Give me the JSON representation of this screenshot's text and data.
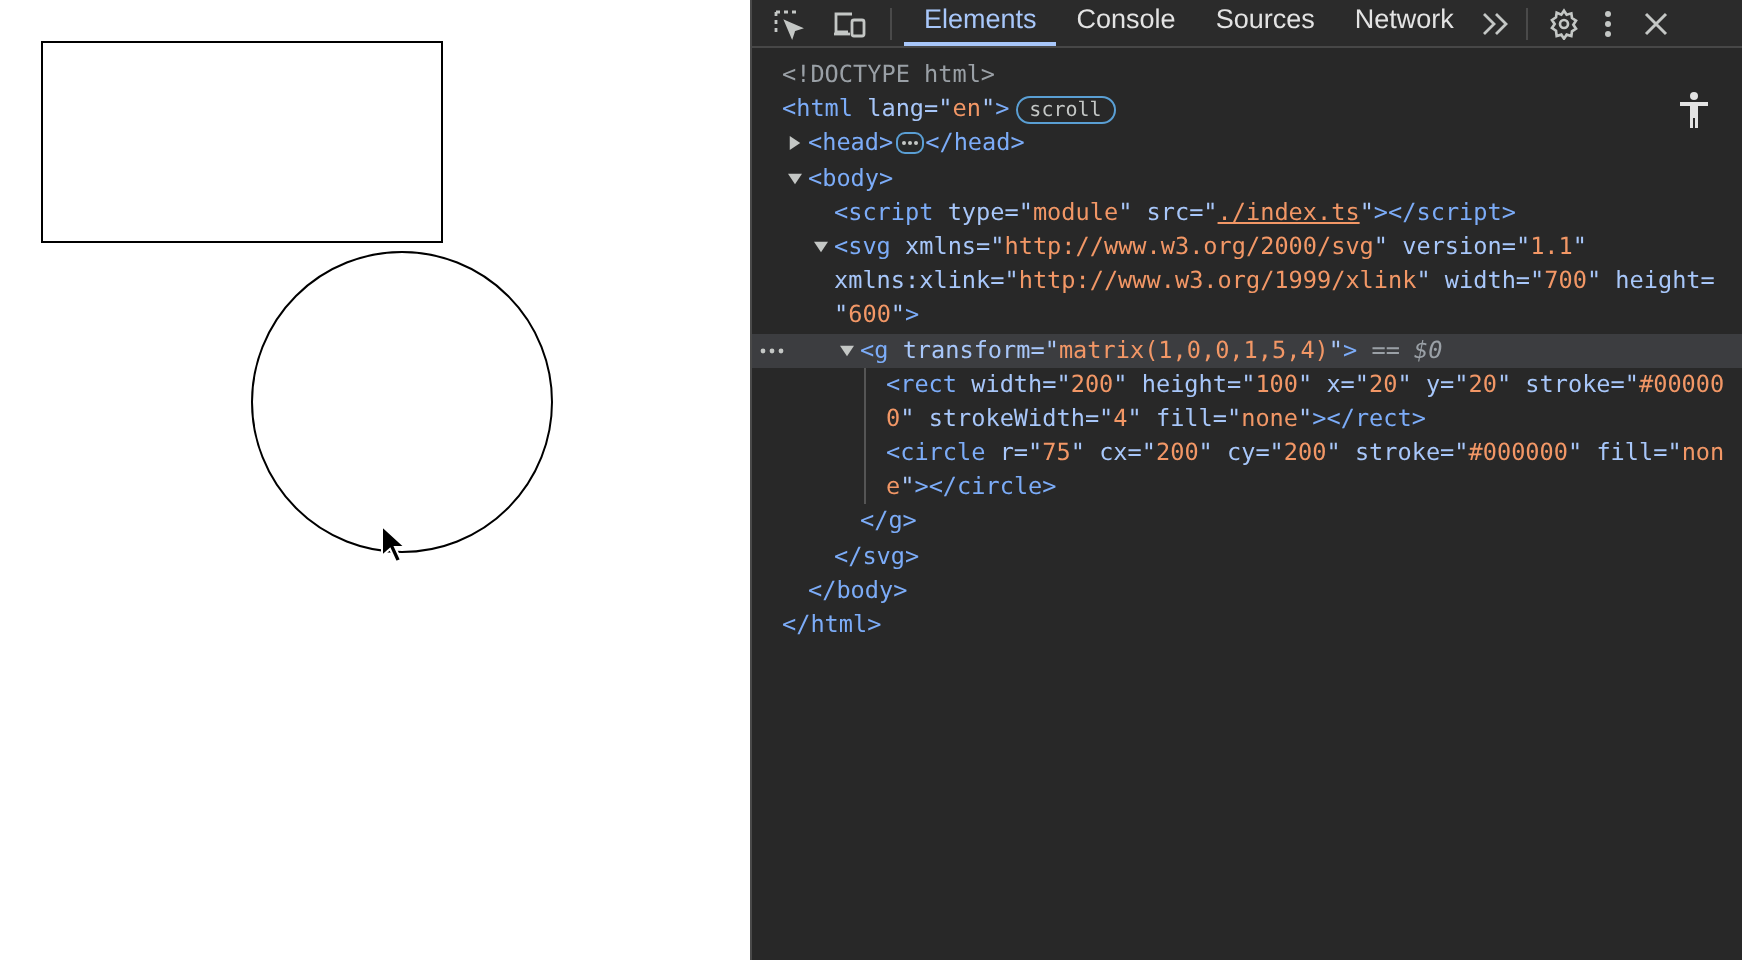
{
  "tabs": [
    {
      "label": "Elements",
      "selected": true
    },
    {
      "label": "Console",
      "selected": false
    },
    {
      "label": "Sources",
      "selected": false
    },
    {
      "label": "Network",
      "selected": false
    }
  ],
  "dom": [
    {
      "lines": [
        [
          {
            "kind": "doctype",
            "text": "<!DOCTYPE html>"
          }
        ]
      ],
      "selected": false
    },
    {
      "lines": [
        [
          {
            "kind": "tag",
            "text": "<html"
          },
          {
            "kind": "attr",
            "text": " lang=\""
          },
          {
            "kind": "value",
            "text": "en"
          },
          {
            "kind": "attr",
            "text": "\""
          },
          {
            "kind": "tag",
            "text": ">"
          }
        ]
      ],
      "badge": "scroll",
      "selected": false,
      "close": [
        {
          "kind": "tag",
          "text": "</html>"
        }
      ],
      "children": [
        {
          "lines": [
            [
              {
                "kind": "tag",
                "text": "<head>"
              }
            ]
          ],
          "selected": false,
          "expanded": false,
          "close": [
            {
              "kind": "tag",
              "text": "</head>"
            }
          ]
        },
        {
          "lines": [
            [
              {
                "kind": "tag",
                "text": "<body>"
              }
            ]
          ],
          "selected": false,
          "expanded": true,
          "close": [
            {
              "kind": "tag",
              "text": "</body>"
            }
          ],
          "children": [
            {
              "lines": [
                [
                  {
                    "kind": "tag",
                    "text": "<script"
                  },
                  {
                    "kind": "attr",
                    "text": " type=\""
                  },
                  {
                    "kind": "value",
                    "text": "module"
                  },
                  {
                    "kind": "attr",
                    "text": "\" src=\""
                  },
                  {
                    "kind": "link",
                    "text": "./index.ts"
                  },
                  {
                    "kind": "attr",
                    "text": "\""
                  },
                  {
                    "kind": "tag",
                    "text": ">"
                  }
                ]
              ],
              "selected": false,
              "close": [
                {
                  "kind": "tag",
                  "text": "</script>"
                }
              ]
            },
            {
              "lines": [
                [
                  {
                    "kind": "tag",
                    "text": "<svg"
                  },
                  {
                    "kind": "attr",
                    "text": " xmlns=\""
                  },
                  {
                    "kind": "value",
                    "text": "http://www.w3.org/2000/svg"
                  },
                  {
                    "kind": "attr",
                    "text": "\" version=\""
                  },
                  {
                    "kind": "value",
                    "text": "1.1"
                  },
                  {
                    "kind": "attr",
                    "text": "\""
                  }
                ],
                [
                  {
                    "kind": "attr",
                    "text": "xmlns:xlink=\""
                  },
                  {
                    "kind": "value",
                    "text": "http://www.w3.org/1999/xlink"
                  },
                  {
                    "kind": "attr",
                    "text": "\" width=\""
                  },
                  {
                    "kind": "value",
                    "text": "700"
                  },
                  {
                    "kind": "attr",
                    "text": "\" height="
                  }
                ],
                [
                  {
                    "kind": "attr",
                    "text": "\""
                  },
                  {
                    "kind": "value",
                    "text": "600"
                  },
                  {
                    "kind": "attr",
                    "text": "\""
                  },
                  {
                    "kind": "tag",
                    "text": ">"
                  }
                ]
              ],
              "selected": false,
              "expanded": true,
              "close": [
                {
                  "kind": "tag",
                  "text": "</svg>"
                }
              ],
              "children": [
                {
                  "lines": [
                    [
                      {
                        "kind": "tag",
                        "text": "<g"
                      },
                      {
                        "kind": "attr",
                        "text": " transform=\""
                      },
                      {
                        "kind": "value",
                        "text": "matrix(1,0,0,1,5,4)"
                      },
                      {
                        "kind": "attr",
                        "text": "\""
                      },
                      {
                        "kind": "tag",
                        "text": ">"
                      },
                      {
                        "kind": "marker",
                        "text": " == $0"
                      }
                    ]
                  ],
                  "selected": true,
                  "expanded": true,
                  "close": [
                    {
                      "kind": "tag",
                      "text": "</g>"
                    }
                  ],
                  "children": [
                    {
                      "lines": [
                        [
                          {
                            "kind": "tag",
                            "text": "<rect"
                          },
                          {
                            "kind": "attr",
                            "text": " width=\""
                          },
                          {
                            "kind": "value",
                            "text": "200"
                          },
                          {
                            "kind": "attr",
                            "text": "\" height=\""
                          },
                          {
                            "kind": "value",
                            "text": "100"
                          },
                          {
                            "kind": "attr",
                            "text": "\" x=\""
                          },
                          {
                            "kind": "value",
                            "text": "20"
                          },
                          {
                            "kind": "attr",
                            "text": "\" y=\""
                          },
                          {
                            "kind": "value",
                            "text": "20"
                          },
                          {
                            "kind": "attr",
                            "text": "\" stroke=\""
                          },
                          {
                            "kind": "value",
                            "text": "#00000"
                          }
                        ],
                        [
                          {
                            "kind": "value",
                            "text": "0"
                          },
                          {
                            "kind": "attr",
                            "text": "\" strokeWidth=\""
                          },
                          {
                            "kind": "value",
                            "text": "4"
                          },
                          {
                            "kind": "attr",
                            "text": "\" fill=\""
                          },
                          {
                            "kind": "value",
                            "text": "none"
                          },
                          {
                            "kind": "attr",
                            "text": "\""
                          },
                          {
                            "kind": "tag",
                            "text": ">"
                          }
                        ]
                      ],
                      "selected": false,
                      "close": [
                        {
                          "kind": "tag",
                          "text": "</rect>"
                        }
                      ]
                    },
                    {
                      "lines": [
                        [
                          {
                            "kind": "tag",
                            "text": "<circle"
                          },
                          {
                            "kind": "attr",
                            "text": " r=\""
                          },
                          {
                            "kind": "value",
                            "text": "75"
                          },
                          {
                            "kind": "attr",
                            "text": "\" cx=\""
                          },
                          {
                            "kind": "value",
                            "text": "200"
                          },
                          {
                            "kind": "attr",
                            "text": "\" cy=\""
                          },
                          {
                            "kind": "value",
                            "text": "200"
                          },
                          {
                            "kind": "attr",
                            "text": "\" stroke=\""
                          },
                          {
                            "kind": "value",
                            "text": "#000000"
                          },
                          {
                            "kind": "attr",
                            "text": "\" fill=\""
                          },
                          {
                            "kind": "value",
                            "text": "non"
                          }
                        ],
                        [
                          {
                            "kind": "value",
                            "text": "e"
                          },
                          {
                            "kind": "attr",
                            "text": "\""
                          },
                          {
                            "kind": "tag",
                            "text": ">"
                          }
                        ]
                      ],
                      "selected": false,
                      "close": [
                        {
                          "kind": "tag",
                          "text": "</circle>"
                        }
                      ]
                    }
                  ]
                }
              ]
            }
          ]
        }
      ]
    }
  ]
}
